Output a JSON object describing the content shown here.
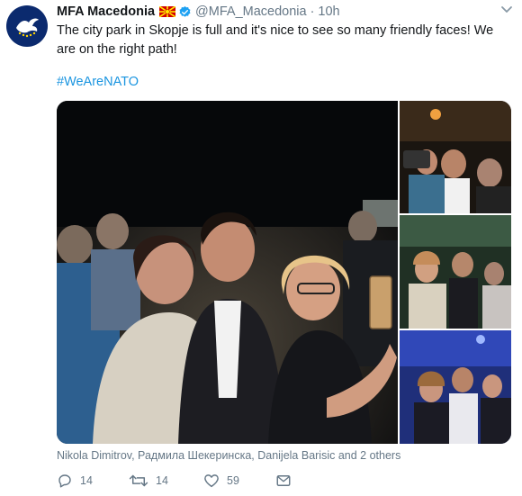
{
  "account": {
    "name": "MFA Macedonia",
    "handle": "@MFA_Macedonia",
    "separator": "·",
    "time": "10h",
    "avatar_icon": "mfa-dove-logo",
    "flag_icon": "macedonia-flag"
  },
  "tweet": {
    "text": "The city park in Skopje is full and it's nice to see so many friendly faces! We are on the right path!",
    "hashtag": "#WeAreNATO"
  },
  "media": {
    "tagged_people": "Nikola Dimitrov, Радмила Шекеринска, Danijela Barisic and 2 others"
  },
  "actions": {
    "reply_count": "14",
    "retweet_count": "14",
    "like_count": "59"
  },
  "colors": {
    "link": "#1b95e0",
    "secondary_text": "#657786",
    "verified": "#1da1f2",
    "avatar_bg": "#0b2a6e"
  }
}
